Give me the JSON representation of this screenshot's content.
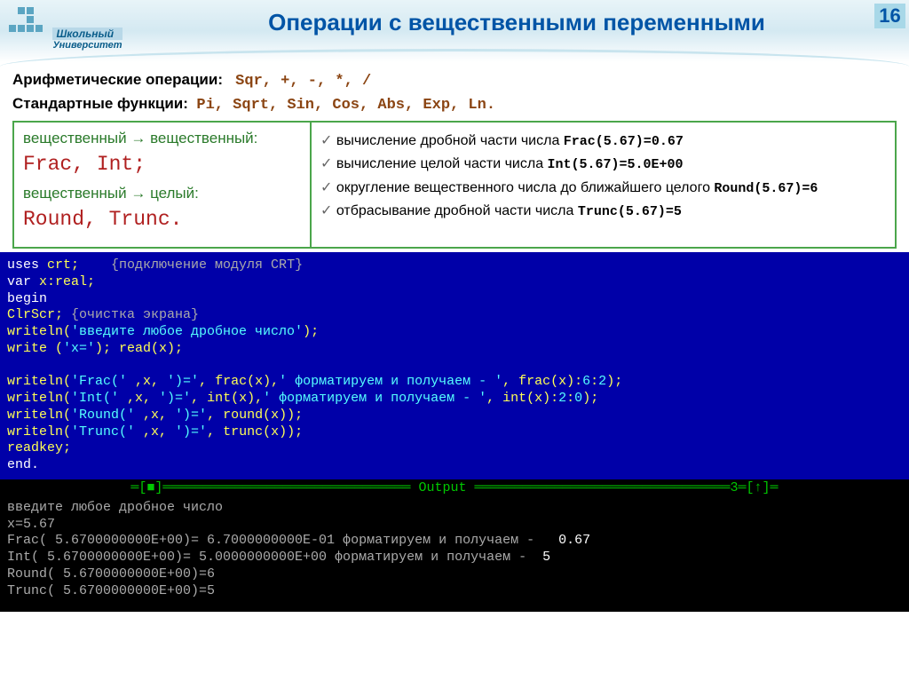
{
  "header": {
    "logo_line1": "Школьный",
    "logo_line2": "Университет",
    "title": "Операции с вещественными переменными",
    "slide_number": "16"
  },
  "intro": {
    "arith_label": "Арифметические операции:",
    "arith_code": "Sqr, +, -, *, /",
    "std_label": "Стандартные функции:",
    "std_code": "Pi, Sqrt, Sin, Cos, Abs, Exp, Ln."
  },
  "left_box": {
    "t1": "вещественный → вещественный:",
    "c1": "Frac, Int;",
    "t2": "вещественный → целый:",
    "c2": "Round, Trunc."
  },
  "checks": {
    "l1a": "вычисление дробной части числа ",
    "l1b": "Frac(5.67)=0.67",
    "l2a": "вычисление целой части числа ",
    "l2b": "Int(5.67)=5.0E+00",
    "l3a": "округление вещественного числа до ближайшего целого ",
    "l3b": "Round(5.67)=6",
    "l4a": "отбрасывание дробной части числа ",
    "l4b": "Trunc(5.67)=5"
  },
  "code": {
    "l01a": "uses ",
    "l01b": "crt;    ",
    "l01c": "{подключение модуля CRT}",
    "l02a": "var ",
    "l02b": "x:real;",
    "l03": "begin",
    "l04a": "ClrScr; ",
    "l04b": "{очистка экрана}",
    "l05a": "writeln(",
    "l05b": "'введите любое дробное число'",
    "l05c": ");",
    "l06a": "write (",
    "l06b": "'x='",
    "l06c": "); read(x);",
    "l07": "",
    "l08a": "writeln(",
    "l08b": "'Frac(' ",
    "l08c": ",x, ",
    "l08d": "')='",
    "l08e": ", frac(x),",
    "l08f": "' форматируем и получаем - '",
    "l08g": ", frac(x):",
    "l08h": "6",
    "l08i": ":",
    "l08j": "2",
    "l08k": ");",
    "l09a": "writeln(",
    "l09b": "'Int(' ",
    "l09c": ",x, ",
    "l09d": "')='",
    "l09e": ", int(x),",
    "l09f": "' форматируем и получаем - '",
    "l09g": ", int(x):",
    "l09h": "2",
    "l09i": ":",
    "l09j": "0",
    "l09k": ");",
    "l10a": "writeln(",
    "l10b": "'Round(' ",
    "l10c": ",x, ",
    "l10d": "')='",
    "l10e": ", round(x));",
    "l11a": "writeln(",
    "l11b": "'Trunc(' ",
    "l11c": ",x, ",
    "l11d": "')='",
    "l11e": ", trunc(x));",
    "l12": "readkey;",
    "l13": "end."
  },
  "output": {
    "sep_left": "═[■]═",
    "sep_label": " Output ",
    "sep_right": "═3═[↑]═",
    "l1": "введите любое дробное число",
    "l2": "x=5.67",
    "l3a": "Frac( 5.6700000000E+00)= 6.7000000000E-01 форматируем и получаем -   ",
    "l3b": "0.67",
    "l4a": "Int( 5.6700000000E+00)= 5.0000000000E+00 форматируем и получаем -  ",
    "l4b": "5",
    "l5": "Round( 5.6700000000E+00)=6",
    "l6": "Trunc( 5.6700000000E+00)=5"
  }
}
